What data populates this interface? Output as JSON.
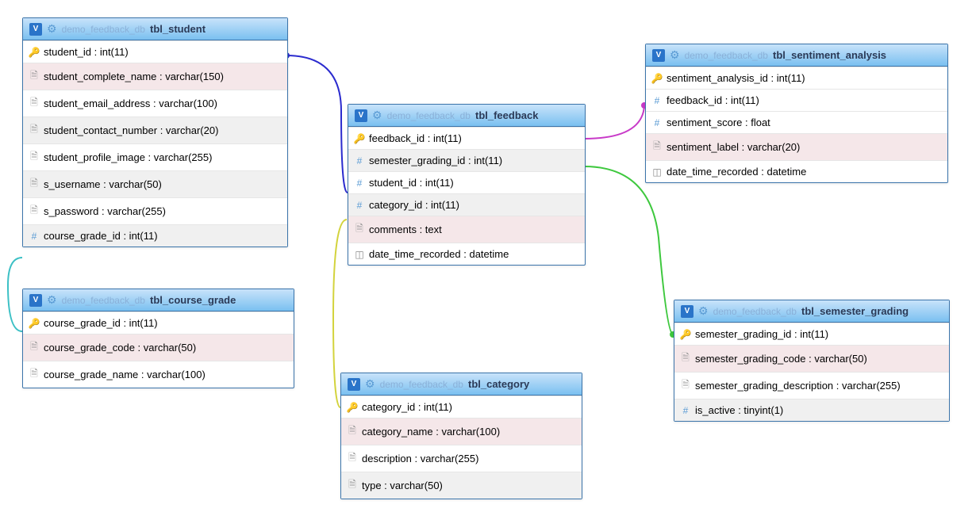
{
  "db": "demo_feedback_db",
  "tables": {
    "student": {
      "name": "tbl_student",
      "cols": [
        {
          "ico": "key",
          "n": "student_id",
          "t": "int(11)"
        },
        {
          "ico": "txt",
          "n": "student_complete_name",
          "t": "varchar(150)",
          "c": "alt"
        },
        {
          "ico": "txt",
          "n": "student_email_address",
          "t": "varchar(100)"
        },
        {
          "ico": "txt",
          "n": "student_contact_number",
          "t": "varchar(20)",
          "c": "gray"
        },
        {
          "ico": "txt",
          "n": "student_profile_image",
          "t": "varchar(255)"
        },
        {
          "ico": "txt",
          "n": "s_username",
          "t": "varchar(50)",
          "c": "gray"
        },
        {
          "ico": "txt",
          "n": "s_password",
          "t": "varchar(255)"
        },
        {
          "ico": "hash",
          "n": "course_grade_id",
          "t": "int(11)",
          "c": "gray"
        }
      ]
    },
    "course": {
      "name": "tbl_course_grade",
      "cols": [
        {
          "ico": "key",
          "n": "course_grade_id",
          "t": "int(11)"
        },
        {
          "ico": "txt",
          "n": "course_grade_code",
          "t": "varchar(50)",
          "c": "alt"
        },
        {
          "ico": "txt",
          "n": "course_grade_name",
          "t": "varchar(100)"
        }
      ]
    },
    "feedback": {
      "name": "tbl_feedback",
      "cols": [
        {
          "ico": "key",
          "n": "feedback_id",
          "t": "int(11)"
        },
        {
          "ico": "hash",
          "n": "semester_grading_id",
          "t": "int(11)",
          "c": "gray"
        },
        {
          "ico": "hash",
          "n": "student_id",
          "t": "int(11)"
        },
        {
          "ico": "hash",
          "n": "category_id",
          "t": "int(11)",
          "c": "gray"
        },
        {
          "ico": "txt",
          "n": "comments",
          "t": "text",
          "c": "alt"
        },
        {
          "ico": "dt",
          "n": "date_time_recorded",
          "t": "datetime"
        }
      ]
    },
    "category": {
      "name": "tbl_category",
      "cols": [
        {
          "ico": "key",
          "n": "category_id",
          "t": "int(11)"
        },
        {
          "ico": "txt",
          "n": "category_name",
          "t": "varchar(100)",
          "c": "alt"
        },
        {
          "ico": "txt",
          "n": "description",
          "t": "varchar(255)"
        },
        {
          "ico": "txt",
          "n": "type",
          "t": "varchar(50)",
          "c": "gray"
        }
      ]
    },
    "sentiment": {
      "name": "tbl_sentiment_analysis",
      "cols": [
        {
          "ico": "key",
          "n": "sentiment_analysis_id",
          "t": "int(11)"
        },
        {
          "ico": "hash",
          "n": "feedback_id",
          "t": "int(11)"
        },
        {
          "ico": "hash",
          "n": "sentiment_score",
          "t": "float"
        },
        {
          "ico": "txt",
          "n": "sentiment_label",
          "t": "varchar(20)",
          "c": "alt"
        },
        {
          "ico": "dt",
          "n": "date_time_recorded",
          "t": "datetime"
        }
      ]
    },
    "semester": {
      "name": "tbl_semester_grading",
      "cols": [
        {
          "ico": "key",
          "n": "semester_grading_id",
          "t": "int(11)"
        },
        {
          "ico": "txt",
          "n": "semester_grading_code",
          "t": "varchar(50)",
          "c": "alt"
        },
        {
          "ico": "txt",
          "n": "semester_grading_description",
          "t": "varchar(255)"
        },
        {
          "ico": "hash",
          "n": "is_active",
          "t": "tinyint(1)",
          "c": "gray"
        }
      ]
    }
  },
  "relations": [
    {
      "from": "tbl_student.course_grade_id",
      "to": "tbl_course_grade.course_grade_id",
      "color": "cyan"
    },
    {
      "from": "tbl_feedback.student_id",
      "to": "tbl_student.student_id",
      "color": "blue"
    },
    {
      "from": "tbl_feedback.category_id",
      "to": "tbl_category.category_id",
      "color": "yellow"
    },
    {
      "from": "tbl_feedback.feedback_id",
      "to": "tbl_sentiment_analysis.feedback_id",
      "color": "magenta"
    },
    {
      "from": "tbl_feedback.semester_grading_id",
      "to": "tbl_semester_grading.semester_grading_id",
      "color": "green"
    }
  ]
}
